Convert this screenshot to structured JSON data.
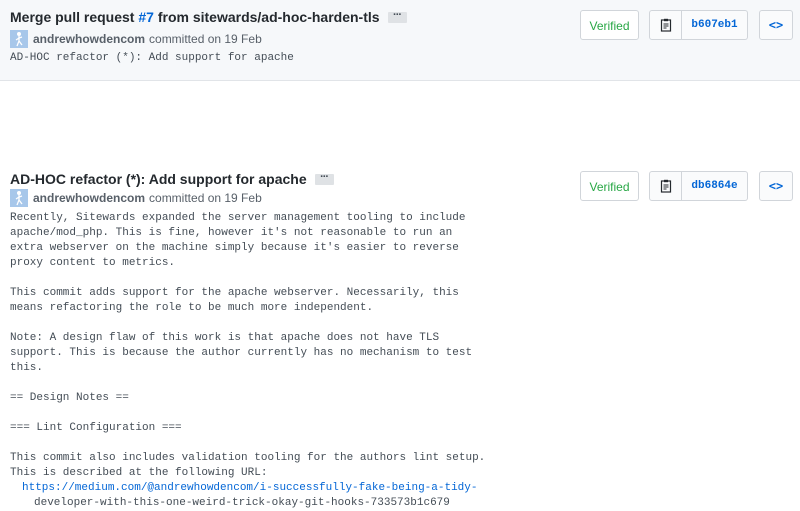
{
  "commits": [
    {
      "title_prefix": "Merge pull request ",
      "pr_number": "#7",
      "title_suffix": " from sitewards/ad-hoc-harden-tls",
      "ellipsis": "···",
      "author": "andrewhowdencom",
      "committed_text": "committed on 19 Feb",
      "message": "AD-HOC refactor (*): Add support for apache",
      "verified_label": "Verified",
      "sha": "b607eb1",
      "clipboard_icon": "clipboard-icon",
      "browse_icon": "code-icon",
      "browse_label": "<>"
    },
    {
      "title": "AD-HOC refactor (*): Add support for apache",
      "ellipsis": "···",
      "author": "andrewhowdencom",
      "committed_text": "committed on 19 Feb",
      "message": "Recently, Sitewards expanded the server management tooling to include\napache/mod_php. This is fine, however it's not reasonable to run an\nextra webserver on the machine simply because it's easier to reverse\nproxy content to metrics.\n\nThis commit adds support for the apache webserver. Necessarily, this\nmeans refactoring the role to be much more independent.\n\nNote: A design flaw of this work is that apache does not have TLS\nsupport. This is because the author currently has no mechanism to test\nthis.\n\n== Design Notes ==\n\n=== Lint Configuration ===\n\nThis commit also includes validation tooling for the authors lint setup.\nThis is described at the following URL:\n",
      "url_line1": "https://medium.com/@andrewhowdencom/i-successfully-fake-being-a-tidy-",
      "url_line2": "developer-with-this-one-weird-trick-okay-git-hooks-733573b1c679",
      "verified_label": "Verified",
      "sha": "db6864e",
      "clipboard_icon": "clipboard-icon",
      "browse_icon": "code-icon",
      "browse_label": "<>"
    }
  ],
  "colors": {
    "link": "#0366d6",
    "verified": "#28a745",
    "header_bg": "#f6f8fa"
  }
}
